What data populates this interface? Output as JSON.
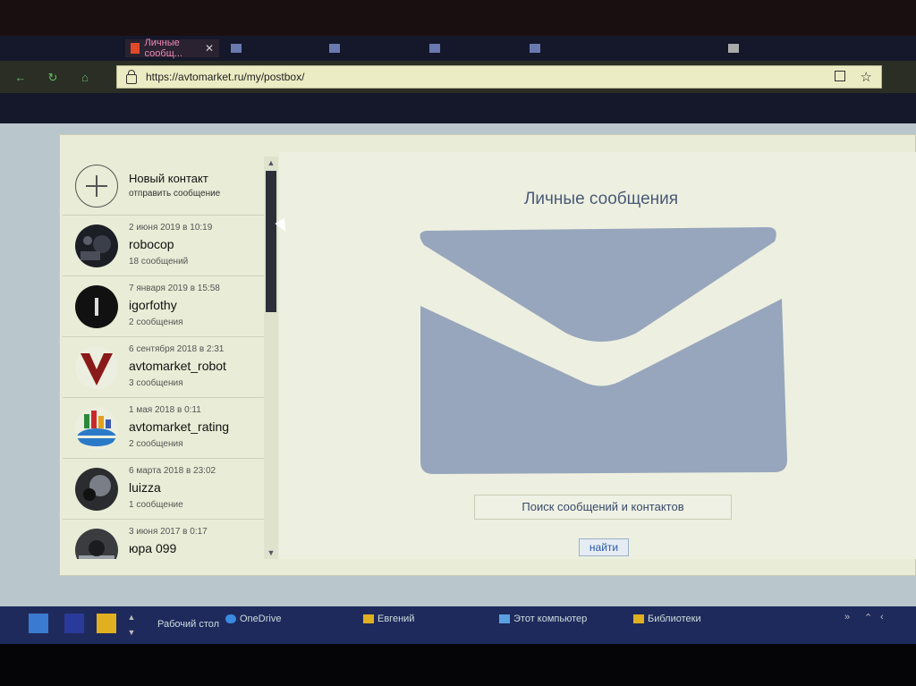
{
  "browser": {
    "active_tab": {
      "label": "Личные сообщ..."
    },
    "address": {
      "url": "https://avtomarket.ru/my/postbox/"
    }
  },
  "sidebar": {
    "new_contact": {
      "title": "Новый контакт",
      "subtitle": "отправить сообщение"
    },
    "contacts": [
      {
        "date": "2 июня 2019 в 10:19",
        "name": "robocop",
        "count": "18 сообщений"
      },
      {
        "date": "7 января 2019 в 15:58",
        "name": "igorfothy",
        "count": "2 сообщения"
      },
      {
        "date": "6 сентября 2018 в 2:31",
        "name": "avtomarket_robot",
        "count": "3 сообщения"
      },
      {
        "date": "1 мая 2018 в 0:11",
        "name": "avtomarket_rating",
        "count": "2 сообщения"
      },
      {
        "date": "6 марта 2018 в 23:02",
        "name": "luizza",
        "count": "1 сообщение"
      },
      {
        "date": "3 июня 2017 в 0:17",
        "name": "юра 099",
        "count": ""
      }
    ]
  },
  "main": {
    "title": "Личные сообщения",
    "search_label": "Поиск сообщений и контактов",
    "find_button": "найти"
  },
  "taskbar": {
    "desktop": "Рабочий стол",
    "onedrive": "OneDrive",
    "user": "Евгений",
    "computer": "Этот компьютер",
    "libraries": "Библиотеки"
  }
}
